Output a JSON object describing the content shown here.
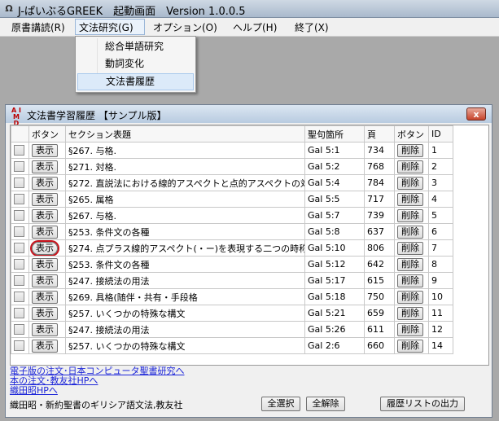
{
  "app": {
    "title": "J-ぱいぶるGREEK　起動画面　Version 1.0.0.5",
    "icon": "app-logo-icon"
  },
  "menu": {
    "items": [
      "原書講読(R)",
      "文法研究(G)",
      "オプション(O)",
      "ヘルプ(H)",
      "終了(X)"
    ]
  },
  "dropdown": {
    "items": [
      "総合単語研究",
      "動詞変化",
      "文法書履歴"
    ],
    "highlighted": "文法書履歴"
  },
  "window": {
    "title": "文法書学習履歴 【サンプル版】",
    "icon_text": "AIMD",
    "close_label": "x",
    "columns": [
      "",
      "ボタン",
      "セクション表題",
      "聖句箇所",
      "頁",
      "ボタン",
      "ID"
    ],
    "show_label": "表示",
    "delete_label": "削除",
    "rows": [
      {
        "section": "§267. 与格.",
        "verse": "Gal 5:1",
        "page": "734",
        "id": "1"
      },
      {
        "section": "§271. 対格.",
        "verse": "Gal 5:2",
        "page": "768",
        "id": "2"
      },
      {
        "section": "§272. 直説法における線的アスペクトと点的アスペクトの対照",
        "verse": "Gal 5:4",
        "page": "784",
        "id": "3"
      },
      {
        "section": "§265. 属格",
        "verse": "Gal 5:5",
        "page": "717",
        "id": "4"
      },
      {
        "section": "§267. 与格.",
        "verse": "Gal 5:7",
        "page": "739",
        "id": "5"
      },
      {
        "section": "§253. 条件文の各種",
        "verse": "Gal 5:8",
        "page": "637",
        "id": "6"
      },
      {
        "section": "§274. 点プラス線的アスペクト(・ー)を表現する二つの時称",
        "verse": "Gal 5:10",
        "page": "806",
        "id": "7",
        "circled": true
      },
      {
        "section": "§253. 条件文の各種",
        "verse": "Gal 5:12",
        "page": "642",
        "id": "8"
      },
      {
        "section": "§247. 接続法の用法",
        "verse": "Gal 5:17",
        "page": "615",
        "id": "9"
      },
      {
        "section": "§269. 具格(随伴・共有・手段格",
        "verse": "Gal 5:18",
        "page": "750",
        "id": "10"
      },
      {
        "section": "§257. いくつかの特殊な構文",
        "verse": "Gal 5:21",
        "page": "659",
        "id": "11"
      },
      {
        "section": "§247. 接続法の用法",
        "verse": "Gal 5:26",
        "page": "611",
        "id": "12"
      },
      {
        "section": "§257. いくつかの特殊な構文",
        "verse": "Gal 2:6",
        "page": "660",
        "id": "14"
      }
    ],
    "links": [
      "電子版の注文･日本コンピュータ聖書研究へ",
      "本の注文･教友社HPへ",
      "織田昭HPへ"
    ],
    "footer_label": "織田昭・新約聖書のギリシア語文法,教友社",
    "select_all": "全選択",
    "deselect_all": "全解除",
    "export": "履歴リストの出力"
  },
  "colors": {
    "background": "#a9a9a9",
    "link": "#1d26d9",
    "highlight_circle": "#c8121b"
  }
}
